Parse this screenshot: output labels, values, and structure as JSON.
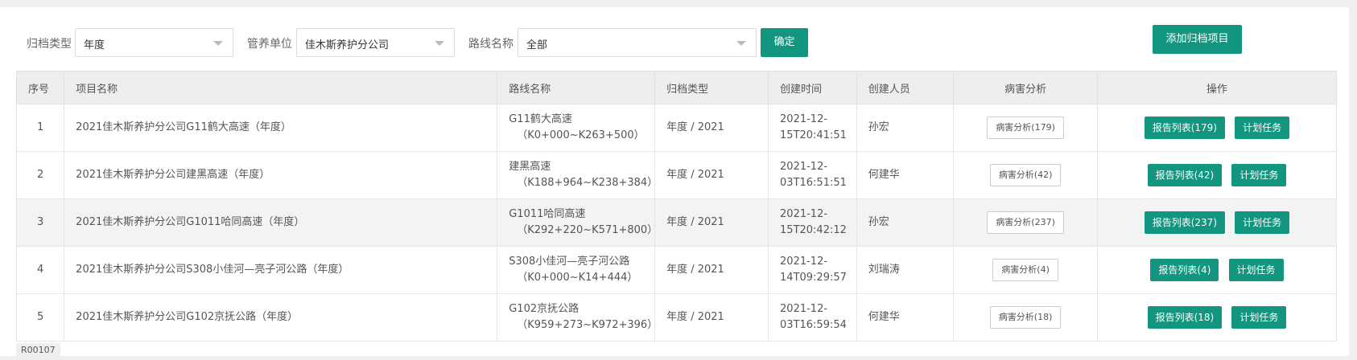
{
  "filters": {
    "type_label": "归档类型",
    "type_value": "年度",
    "unit_label": "管养单位",
    "unit_value": "佳木斯养护分公司",
    "route_label": "路线名称",
    "route_value": "全部",
    "confirm_label": "确定"
  },
  "add_button_label": "添加归档项目",
  "table": {
    "headers": [
      "序号",
      "项目名称",
      "路线名称",
      "归档类型",
      "创建时间",
      "创建人员",
      "病害分析",
      "操作"
    ],
    "rows": [
      {
        "no": "1",
        "name": "2021佳木斯养护分公司G11鹤大高速（年度）",
        "route_line1": "G11鹤大高速",
        "route_line2": "（K0+000~K263+500）",
        "type": "年度 / 2021",
        "time_line1": "2021-12-",
        "time_line2": "15T20:41:51",
        "creator": "孙宏",
        "analysis": "病害分析(179)",
        "report": "报告列表(179)",
        "plan": "计划任务"
      },
      {
        "no": "2",
        "name": "2021佳木斯养护分公司建黑高速（年度）",
        "route_line1": "建黑高速",
        "route_line2": "（K188+964~K238+384）",
        "type": "年度 / 2021",
        "time_line1": "2021-12-",
        "time_line2": "03T16:51:51",
        "creator": "何建华",
        "analysis": "病害分析(42)",
        "report": "报告列表(42)",
        "plan": "计划任务"
      },
      {
        "no": "3",
        "name": "2021佳木斯养护分公司G1011哈同高速（年度）",
        "route_line1": "G1011哈同高速",
        "route_line2": "（K292+220~K571+800）",
        "type": "年度 / 2021",
        "time_line1": "2021-12-",
        "time_line2": "15T20:42:12",
        "creator": "孙宏",
        "analysis": "病害分析(237)",
        "report": "报告列表(237)",
        "plan": "计划任务"
      },
      {
        "no": "4",
        "name": "2021佳木斯养护分公司S308小佳河—亮子河公路（年度）",
        "route_line1": "S308小佳河—亮子河公路",
        "route_line2": "（K0+000~K14+444）",
        "type": "年度 / 2021",
        "time_line1": "2021-12-",
        "time_line2": "14T09:29:57",
        "creator": "刘瑞涛",
        "analysis": "病害分析(4)",
        "report": "报告列表(4)",
        "plan": "计划任务"
      },
      {
        "no": "5",
        "name": "2021佳木斯养护分公司G102京抚公路（年度）",
        "route_line1": "G102京抚公路",
        "route_line2": "（K959+273~K972+396）",
        "type": "年度 / 2021",
        "time_line1": "2021-12-",
        "time_line2": "03T16:59:54",
        "creator": "何建华",
        "analysis": "病害分析(18)",
        "report": "报告列表(18)",
        "plan": "计划任务"
      }
    ]
  },
  "page_code": "R00107",
  "colors": {
    "accent": "#12967f",
    "header_bg": "#eeeeee",
    "alt_row_bg": "#f3f3f3"
  }
}
